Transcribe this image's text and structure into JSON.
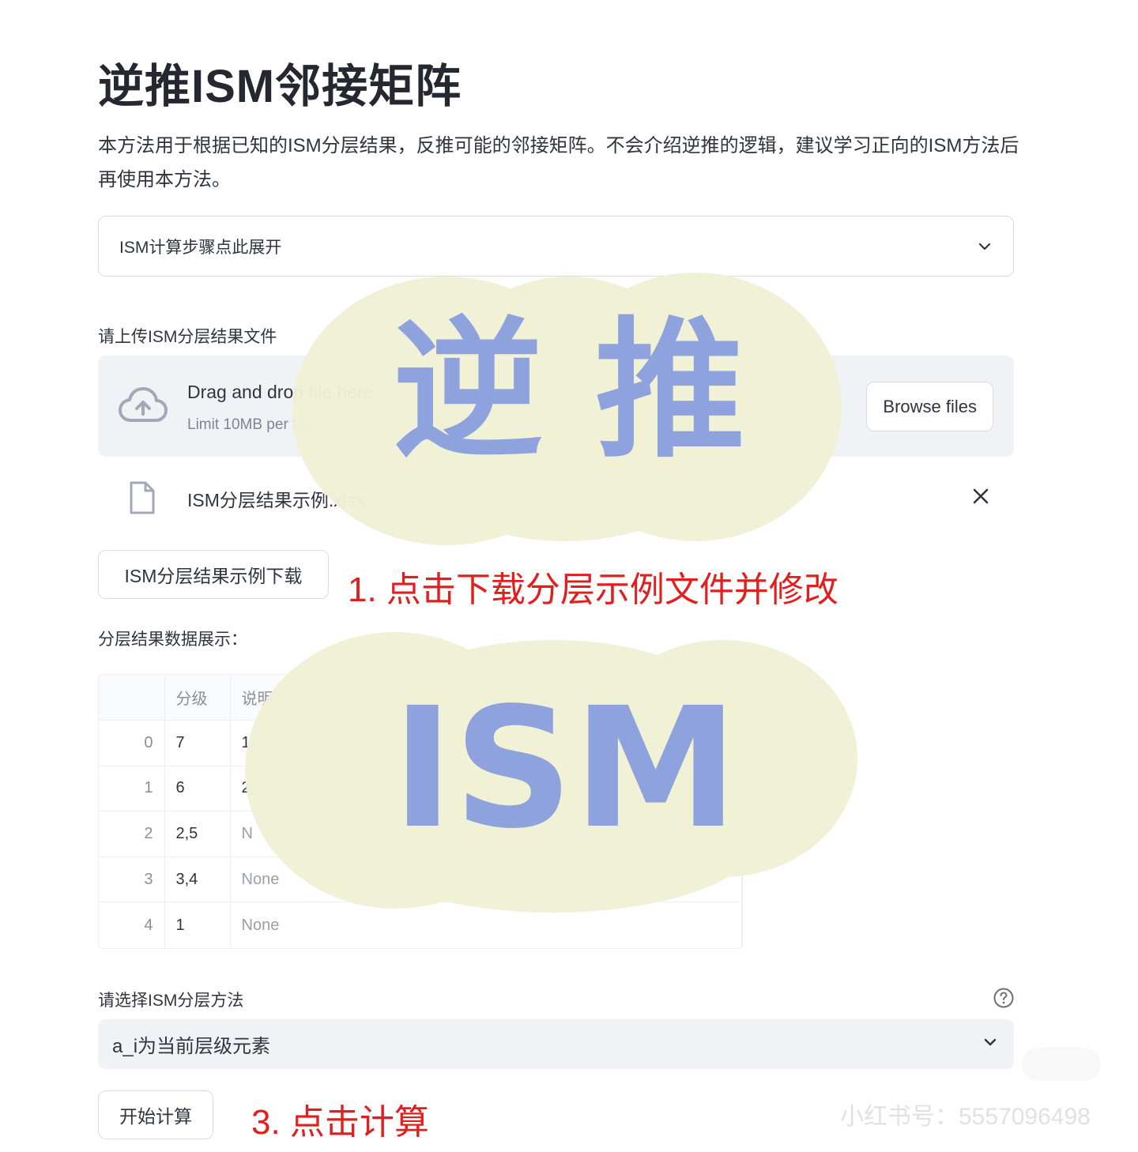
{
  "page": {
    "title": "逆推ISM邻接矩阵",
    "intro": "本方法用于根据已知的ISM分层结果，反推可能的邻接矩阵。不会介绍逆推的逻辑，建议学习正向的ISM方法后再使用本方法。"
  },
  "expander": {
    "label": "ISM计算步骤点此展开",
    "icon": "chevron-down-icon"
  },
  "upload": {
    "label": "请上传ISM分层结果文件",
    "drop_text": "Drag and drop file here",
    "limit_text": "Limit 10MB per file",
    "browse_label": "Browse files",
    "file_name": "ISM分层结果示例.xlsx"
  },
  "download_button": {
    "label": "ISM分层结果示例下载"
  },
  "annotations": {
    "step1": "1. 点击下载分层示例文件并修改",
    "step3": "3. 点击计算"
  },
  "table": {
    "label": "分层结果数据展示：",
    "columns": [
      "",
      "分级",
      "说明"
    ],
    "rows": [
      {
        "index": "0",
        "level": "7",
        "desc": "1."
      },
      {
        "index": "1",
        "level": "6",
        "desc": "2"
      },
      {
        "index": "2",
        "level": "2,5",
        "desc": "N"
      },
      {
        "index": "3",
        "level": "3,4",
        "desc": "None"
      },
      {
        "index": "4",
        "level": "1",
        "desc": "None"
      }
    ]
  },
  "method": {
    "label": "请选择ISM分层方法",
    "selected": "a_i为当前层级元素",
    "help_icon": "question-circle-icon"
  },
  "start_button": {
    "label": "开始计算"
  },
  "overlay": {
    "big_text_1": "逆 推",
    "big_text_2": "ISM",
    "bubble_color": "#f1f1d6",
    "letter_color": "#8ea2dd"
  },
  "watermark": "小红书号：5557096498"
}
